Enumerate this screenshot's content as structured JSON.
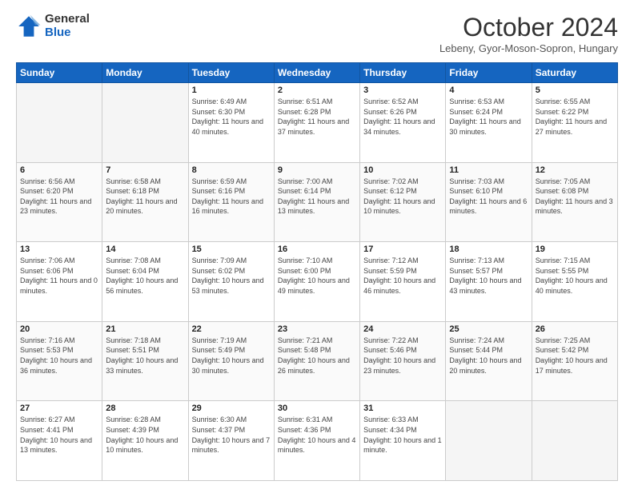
{
  "header": {
    "logo_general": "General",
    "logo_blue": "Blue",
    "month_title": "October 2024",
    "subtitle": "Lebeny, Gyor-Moson-Sopron, Hungary"
  },
  "days_of_week": [
    "Sunday",
    "Monday",
    "Tuesday",
    "Wednesday",
    "Thursday",
    "Friday",
    "Saturday"
  ],
  "weeks": [
    [
      {
        "day": "",
        "empty": true
      },
      {
        "day": "",
        "empty": true
      },
      {
        "day": "1",
        "sunrise": "6:49 AM",
        "sunset": "6:30 PM",
        "daylight": "11 hours and 40 minutes."
      },
      {
        "day": "2",
        "sunrise": "6:51 AM",
        "sunset": "6:28 PM",
        "daylight": "11 hours and 37 minutes."
      },
      {
        "day": "3",
        "sunrise": "6:52 AM",
        "sunset": "6:26 PM",
        "daylight": "11 hours and 34 minutes."
      },
      {
        "day": "4",
        "sunrise": "6:53 AM",
        "sunset": "6:24 PM",
        "daylight": "11 hours and 30 minutes."
      },
      {
        "day": "5",
        "sunrise": "6:55 AM",
        "sunset": "6:22 PM",
        "daylight": "11 hours and 27 minutes."
      }
    ],
    [
      {
        "day": "6",
        "sunrise": "6:56 AM",
        "sunset": "6:20 PM",
        "daylight": "11 hours and 23 minutes."
      },
      {
        "day": "7",
        "sunrise": "6:58 AM",
        "sunset": "6:18 PM",
        "daylight": "11 hours and 20 minutes."
      },
      {
        "day": "8",
        "sunrise": "6:59 AM",
        "sunset": "6:16 PM",
        "daylight": "11 hours and 16 minutes."
      },
      {
        "day": "9",
        "sunrise": "7:00 AM",
        "sunset": "6:14 PM",
        "daylight": "11 hours and 13 minutes."
      },
      {
        "day": "10",
        "sunrise": "7:02 AM",
        "sunset": "6:12 PM",
        "daylight": "11 hours and 10 minutes."
      },
      {
        "day": "11",
        "sunrise": "7:03 AM",
        "sunset": "6:10 PM",
        "daylight": "11 hours and 6 minutes."
      },
      {
        "day": "12",
        "sunrise": "7:05 AM",
        "sunset": "6:08 PM",
        "daylight": "11 hours and 3 minutes."
      }
    ],
    [
      {
        "day": "13",
        "sunrise": "7:06 AM",
        "sunset": "6:06 PM",
        "daylight": "11 hours and 0 minutes."
      },
      {
        "day": "14",
        "sunrise": "7:08 AM",
        "sunset": "6:04 PM",
        "daylight": "10 hours and 56 minutes."
      },
      {
        "day": "15",
        "sunrise": "7:09 AM",
        "sunset": "6:02 PM",
        "daylight": "10 hours and 53 minutes."
      },
      {
        "day": "16",
        "sunrise": "7:10 AM",
        "sunset": "6:00 PM",
        "daylight": "10 hours and 49 minutes."
      },
      {
        "day": "17",
        "sunrise": "7:12 AM",
        "sunset": "5:59 PM",
        "daylight": "10 hours and 46 minutes."
      },
      {
        "day": "18",
        "sunrise": "7:13 AM",
        "sunset": "5:57 PM",
        "daylight": "10 hours and 43 minutes."
      },
      {
        "day": "19",
        "sunrise": "7:15 AM",
        "sunset": "5:55 PM",
        "daylight": "10 hours and 40 minutes."
      }
    ],
    [
      {
        "day": "20",
        "sunrise": "7:16 AM",
        "sunset": "5:53 PM",
        "daylight": "10 hours and 36 minutes."
      },
      {
        "day": "21",
        "sunrise": "7:18 AM",
        "sunset": "5:51 PM",
        "daylight": "10 hours and 33 minutes."
      },
      {
        "day": "22",
        "sunrise": "7:19 AM",
        "sunset": "5:49 PM",
        "daylight": "10 hours and 30 minutes."
      },
      {
        "day": "23",
        "sunrise": "7:21 AM",
        "sunset": "5:48 PM",
        "daylight": "10 hours and 26 minutes."
      },
      {
        "day": "24",
        "sunrise": "7:22 AM",
        "sunset": "5:46 PM",
        "daylight": "10 hours and 23 minutes."
      },
      {
        "day": "25",
        "sunrise": "7:24 AM",
        "sunset": "5:44 PM",
        "daylight": "10 hours and 20 minutes."
      },
      {
        "day": "26",
        "sunrise": "7:25 AM",
        "sunset": "5:42 PM",
        "daylight": "10 hours and 17 minutes."
      }
    ],
    [
      {
        "day": "27",
        "sunrise": "6:27 AM",
        "sunset": "4:41 PM",
        "daylight": "10 hours and 13 minutes."
      },
      {
        "day": "28",
        "sunrise": "6:28 AM",
        "sunset": "4:39 PM",
        "daylight": "10 hours and 10 minutes."
      },
      {
        "day": "29",
        "sunrise": "6:30 AM",
        "sunset": "4:37 PM",
        "daylight": "10 hours and 7 minutes."
      },
      {
        "day": "30",
        "sunrise": "6:31 AM",
        "sunset": "4:36 PM",
        "daylight": "10 hours and 4 minutes."
      },
      {
        "day": "31",
        "sunrise": "6:33 AM",
        "sunset": "4:34 PM",
        "daylight": "10 hours and 1 minute."
      },
      {
        "day": "",
        "empty": true
      },
      {
        "day": "",
        "empty": true
      }
    ]
  ],
  "labels": {
    "sunrise": "Sunrise:",
    "sunset": "Sunset:",
    "daylight": "Daylight:"
  }
}
